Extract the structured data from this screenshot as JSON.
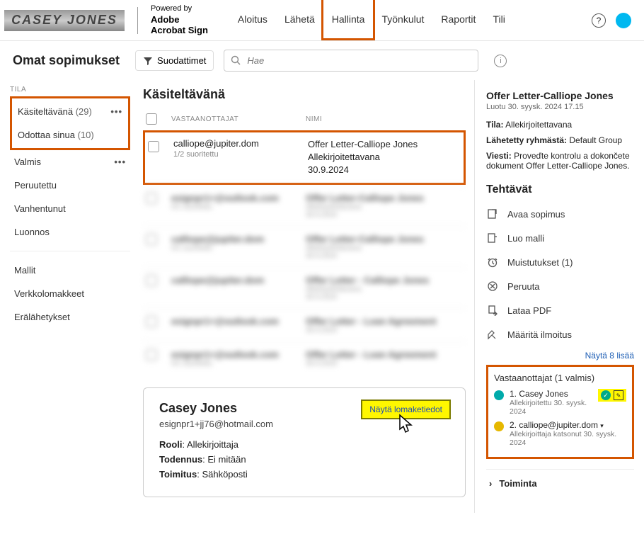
{
  "topbar": {
    "logo_text": "CASEY  JONES",
    "powered_label": "Powered by",
    "powered_brand1": "Adobe",
    "powered_brand2": "Acrobat Sign",
    "nav": [
      "Aloitus",
      "Lähetä",
      "Hallinta",
      "Työnkulut",
      "Raportit",
      "Tili"
    ],
    "active_nav": "Hallinta"
  },
  "subheader": {
    "title": "Omat sopimukset",
    "filter_label": "Suodattimet",
    "search_placeholder": "Hae"
  },
  "sidebar": {
    "tila_label": "TILA",
    "items_boxed": [
      {
        "label": "Käsiteltävänä",
        "count": "(29)",
        "dots": true
      },
      {
        "label": "Odottaa sinua",
        "count": "(10)",
        "dots": false
      }
    ],
    "items_rest": [
      {
        "label": "Valmis",
        "dots": true
      },
      {
        "label": "Peruutettu"
      },
      {
        "label": "Vanhentunut"
      },
      {
        "label": "Luonnos"
      }
    ],
    "items_bottom": [
      "Mallit",
      "Verkkolomakkeet",
      "Erälähetykset"
    ]
  },
  "content": {
    "heading": "Käsiteltävänä",
    "col_recipients": "VASTAANOTTAJAT",
    "col_name": "NIMI",
    "row": {
      "recipient": "calliope@jupiter.dom",
      "progress": "1/2 suoritettu",
      "name_line1": "Offer Letter-Calliope Jones",
      "name_line2": "Allekirjoitettavana",
      "name_line3": "30.9.2024"
    },
    "detail": {
      "person": "Casey Jones",
      "email": "esignpr1+jj76@hotmail.com",
      "role_label": "Rooli",
      "role_value": "Allekirjoittaja",
      "auth_label": "Todennus",
      "auth_value": "Ei mitään",
      "delivery_label": "Toimitus",
      "delivery_value": "Sähköposti",
      "formdata_btn": "Näytä lomaketiedot"
    }
  },
  "rightpane": {
    "title": "Offer Letter-Calliope Jones",
    "created": "Luotu 30. syysk. 2024 17.15",
    "status_label": "Tila:",
    "status_value": "Allekirjoitettavana",
    "group_label": "Lähetetty ryhmästä:",
    "group_value": "Default Group",
    "message_label": "Viesti:",
    "message_value": "Proveďte kontrolu a dokončete dokument Offer Letter-Calliope Jones.",
    "tasks_heading": "Tehtävät",
    "tasks": [
      "Avaa sopimus",
      "Luo malli",
      "Muistutukset (1)",
      "Peruuta",
      "Lataa PDF",
      "Määritä ilmoitus"
    ],
    "show_more": "Näytä 8 lisää",
    "recipients_heading": "Vastaanottajat (1 valmis)",
    "recipients": [
      {
        "num": "1.",
        "name": "Casey Jones",
        "sub": "Allekirjoitettu 30. syysk. 2024",
        "color": "#0aa",
        "done": true
      },
      {
        "num": "2.",
        "name": "calliope@jupiter.dom",
        "sub": "Allekirjoittaja katsonut 30. syysk. 2024",
        "color": "#e6b800",
        "done": false
      }
    ],
    "timeline": "Toiminta"
  }
}
